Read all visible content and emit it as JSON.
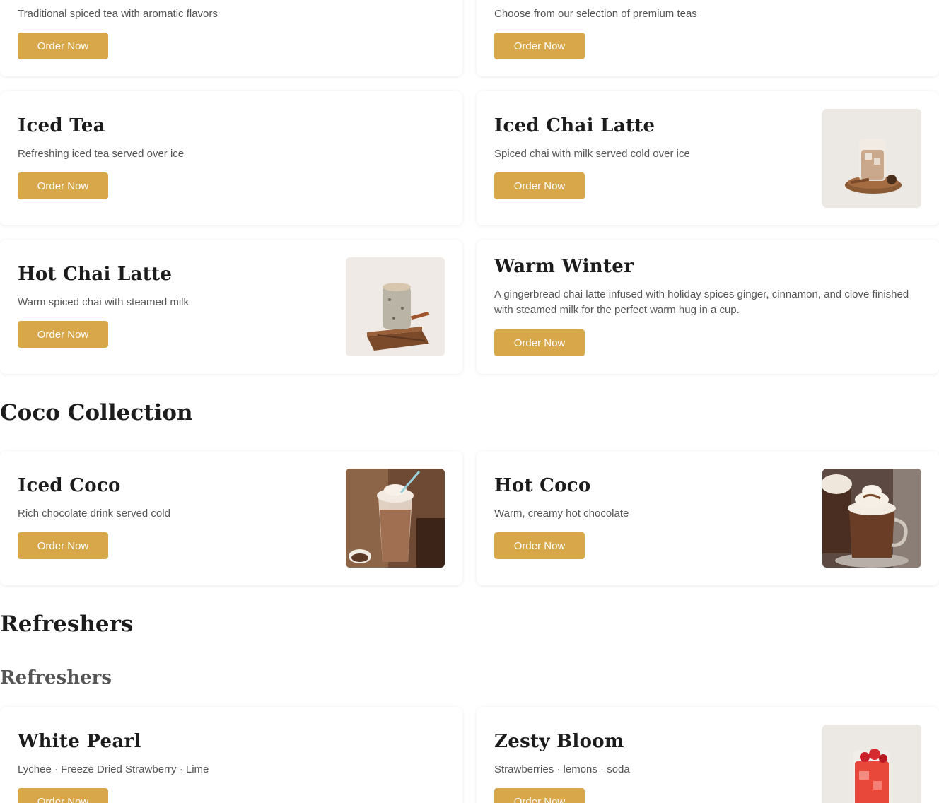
{
  "tea": {
    "cards": [
      {
        "description": "Traditional spiced tea with aromatic flavors",
        "button": "Order Now"
      },
      {
        "description": "Choose from our selection of premium teas",
        "button": "Order Now"
      },
      {
        "title": "Iced Tea",
        "description": "Refreshing iced tea served over ice",
        "button": "Order Now"
      },
      {
        "title": "Iced Chai Latte",
        "description": "Spiced chai with milk served cold over ice",
        "button": "Order Now",
        "image": "iced-chai-latte-photo"
      },
      {
        "title": "Hot Chai Latte",
        "description": "Warm spiced chai with steamed milk",
        "button": "Order Now",
        "image": "hot-chai-latte-photo"
      },
      {
        "title": "Warm Winter",
        "description": "A gingerbread chai latte infused with holiday spices ginger, cinnamon, and clove finished with steamed milk for the perfect warm hug in a cup.",
        "button": "Order Now"
      }
    ]
  },
  "coco": {
    "section_title": "Coco Collection",
    "cards": [
      {
        "title": "Iced Coco",
        "description": "Rich chocolate drink served cold",
        "button": "Order Now",
        "image": "iced-coco-photo"
      },
      {
        "title": "Hot Coco",
        "description": "Warm, creamy hot chocolate",
        "button": "Order Now",
        "image": "hot-coco-photo"
      }
    ]
  },
  "refreshers": {
    "section_title": "Refreshers",
    "subsection_title": "Refreshers",
    "cards": [
      {
        "title": "White Pearl",
        "description": "Lychee · Freeze Dried Strawberry · Lime",
        "button": "Order Now"
      },
      {
        "title": "Zesty Bloom",
        "description": "Strawberries · lemons · soda",
        "button": "Order Now",
        "image": "zesty-bloom-photo"
      }
    ]
  },
  "colors": {
    "button": "#d7a74a",
    "heading": "#1c1c1c",
    "body_text": "#555555"
  }
}
